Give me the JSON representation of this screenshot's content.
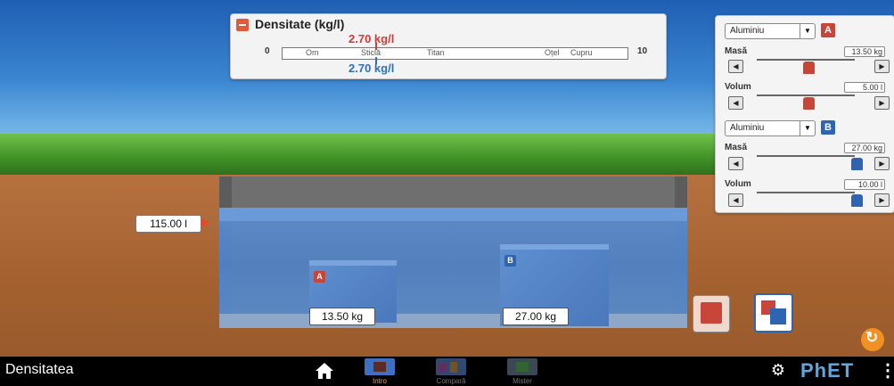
{
  "density_panel": {
    "title": "Densitate  (kg/l)",
    "mass_density_value": "2.70 kg/l",
    "volume_density_value": "2.70 kg/l",
    "scale_min": "0",
    "scale_max": "10",
    "reference_materials": [
      "Om",
      "Sticlă",
      "Titan",
      "Oțel",
      "Cupru"
    ]
  },
  "block_a": {
    "material": "Aluminiu",
    "badge": "A",
    "mass_label": "Masă",
    "mass_value": "13.50 kg",
    "volume_label": "Volum",
    "volume_value": "5.00 l",
    "mass_fraction": 0.5,
    "volume_fraction": 0.5,
    "color": "#c8453a"
  },
  "block_b": {
    "material": "Aluminiu",
    "badge": "B",
    "mass_label": "Masă",
    "mass_value": "27.00 kg",
    "volume_label": "Volum",
    "volume_value": "10.00 l",
    "mass_fraction": 1.0,
    "volume_fraction": 1.0,
    "color": "#2f64b0"
  },
  "pool": {
    "water_level": "115.00 l",
    "block_a_mass": "13.50 kg",
    "block_b_mass": "27.00 kg",
    "block_a_tag": "A",
    "block_b_tag": "B"
  },
  "navbar": {
    "app_title": "Densitatea",
    "screens": [
      {
        "label": "Intro",
        "selected": true
      },
      {
        "label": "Compară",
        "selected": false
      },
      {
        "label": "Mister",
        "selected": false
      }
    ],
    "logo": "PhET",
    "menu": "⋮"
  },
  "colors": {
    "accent_orange": "#f39023",
    "mass_red": "#d13a3a",
    "volume_blue": "#2f6fb5",
    "water_blue": "#4f82c5"
  },
  "icons": [
    "collapse-icon",
    "dropdown-arrow-icon",
    "left-arrow-icon",
    "right-arrow-icon",
    "home-icon",
    "settings-icon",
    "reset-icon"
  ]
}
